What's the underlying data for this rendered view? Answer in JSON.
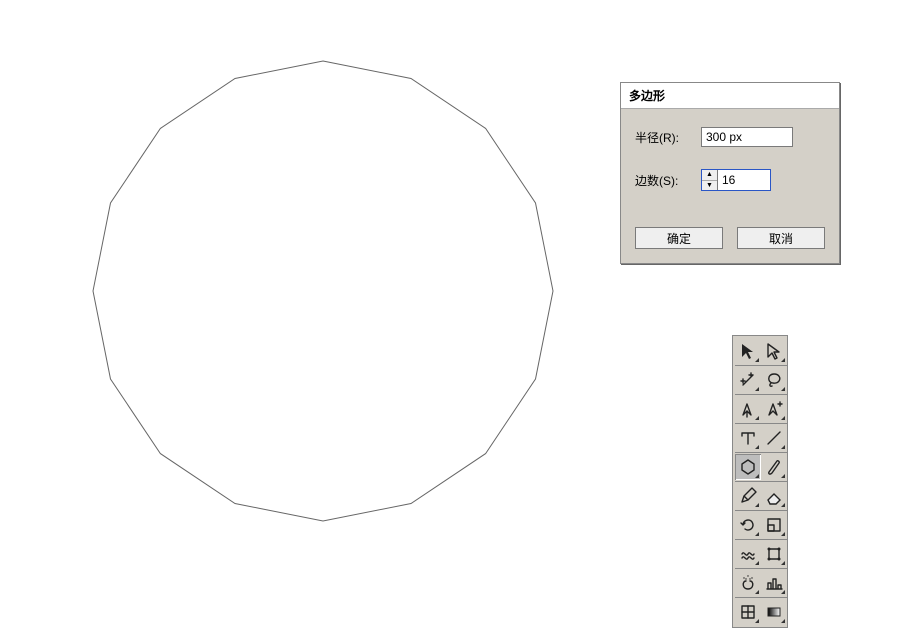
{
  "dialog": {
    "title": "多边形",
    "radius_label": "半径(R):",
    "radius_value": "300 px",
    "sides_label": "边数(S):",
    "sides_value": "16",
    "ok_label": "确定",
    "cancel_label": "取消"
  },
  "shape": {
    "sides": 16,
    "radius_px": 230
  },
  "tools": [
    {
      "name": "selection-tool",
      "icon": "arrow-solid"
    },
    {
      "name": "direct-selection-tool",
      "icon": "arrow-outline"
    },
    {
      "name": "magic-wand-tool",
      "icon": "wand"
    },
    {
      "name": "lasso-tool",
      "icon": "lasso"
    },
    {
      "name": "pen-tool",
      "icon": "pen"
    },
    {
      "name": "add-anchor-tool",
      "icon": "pen-plus"
    },
    {
      "name": "type-tool",
      "icon": "type"
    },
    {
      "name": "line-segment-tool",
      "icon": "line"
    },
    {
      "name": "polygon-tool",
      "icon": "hexagon",
      "selected": true
    },
    {
      "name": "paintbrush-tool",
      "icon": "brush"
    },
    {
      "name": "pencil-tool",
      "icon": "pencil"
    },
    {
      "name": "eraser-tool",
      "icon": "eraser"
    },
    {
      "name": "rotate-tool",
      "icon": "rotate"
    },
    {
      "name": "scale-tool",
      "icon": "scale"
    },
    {
      "name": "warp-tool",
      "icon": "warp"
    },
    {
      "name": "free-transform-tool",
      "icon": "free-transform"
    },
    {
      "name": "symbol-sprayer-tool",
      "icon": "spray"
    },
    {
      "name": "column-graph-tool",
      "icon": "graph"
    },
    {
      "name": "mesh-tool",
      "icon": "mesh"
    },
    {
      "name": "gradient-tool",
      "icon": "gradient"
    }
  ]
}
